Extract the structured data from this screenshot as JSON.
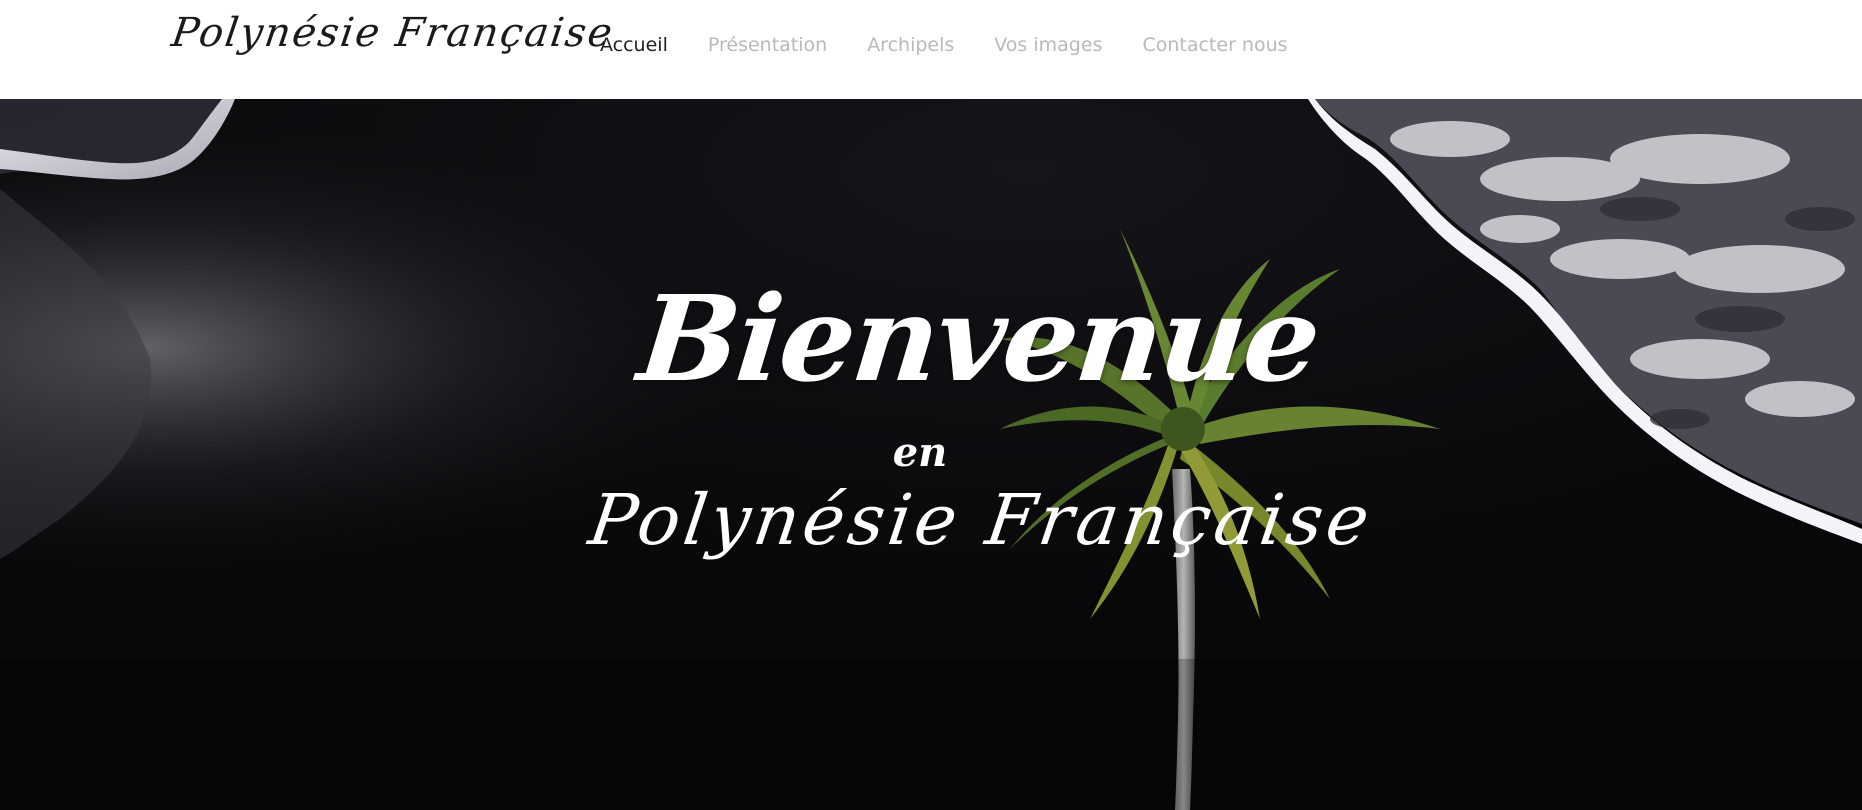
{
  "brand": {
    "name": "Polynésie Française"
  },
  "nav": {
    "items": [
      {
        "label": "Accueil",
        "active": true
      },
      {
        "label": "Présentation",
        "active": false
      },
      {
        "label": "Archipels",
        "active": false
      },
      {
        "label": "Vos images",
        "active": false
      },
      {
        "label": "Contacter nous",
        "active": false
      }
    ]
  },
  "hero": {
    "title_line1": "Bienvenue",
    "title_line2": "en",
    "title_line3": "Polynésie Française"
  },
  "colors": {
    "nav_active": "#1f1f1f",
    "nav_inactive": "#b9b9b9",
    "hero_background": "#0a0a0b",
    "hero_text": "#ffffff"
  }
}
